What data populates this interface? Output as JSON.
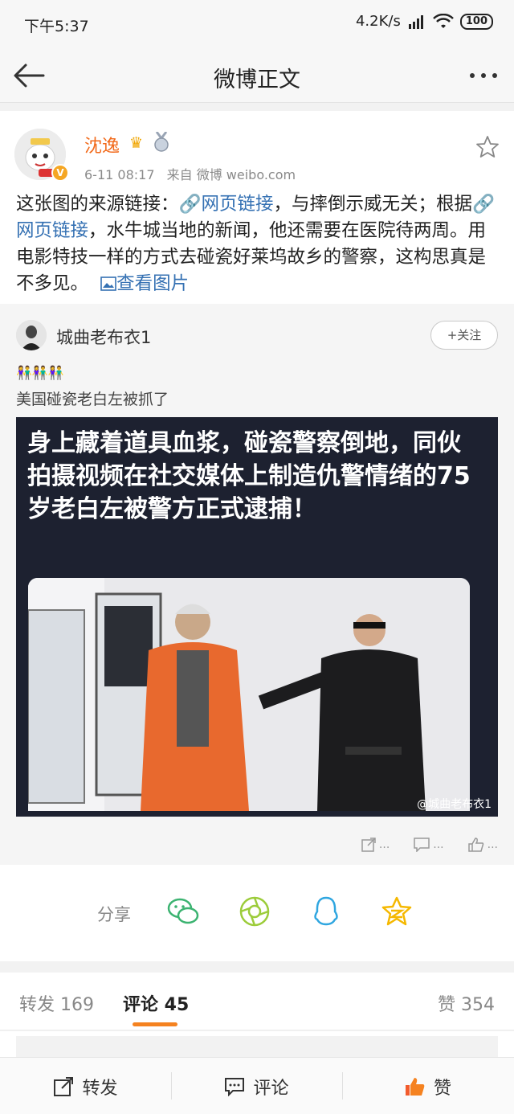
{
  "status_bar": {
    "time": "下午5:37",
    "net_speed": "4.2K/s",
    "battery": "100"
  },
  "nav": {
    "title": "微博正文"
  },
  "post": {
    "author": "沈逸",
    "time": "6-11 08:17",
    "source": "来自 微博 weibo.com",
    "text_1": "这张图的来源链接：",
    "link_1": "网页链接",
    "text_2": "，与摔倒示威无关；根据",
    "link_2": "网页链接",
    "text_3": "，水牛城当地的新闻，他还需要在医院待两周。用电影特技一样的方式去碰瓷好莱坞故乡的警察，这构思真是不多见。",
    "view_image": "查看图片"
  },
  "retweet": {
    "author": "城曲老布衣1",
    "follow_label": "+关注",
    "emoji": "👫👫👫",
    "text": "美国碰瓷老白左被抓了",
    "image_caption": "身上藏着道具血浆，碰瓷警察倒地，同伙拍摄视频在社交媒体上制造仇警情绪的75岁老白左被警方正式逮捕！",
    "watermark": "@城曲老布衣1",
    "actions": {
      "repost": "...",
      "comment": "...",
      "like": "..."
    }
  },
  "share": {
    "label": "分享"
  },
  "tabs": {
    "repost": "转发 169",
    "comment": "评论 45",
    "like": "赞 354"
  },
  "bottom": {
    "repost": "转发",
    "comment": "评论",
    "like": "赞"
  },
  "colors": {
    "accent": "#f58220",
    "link": "#3571b3",
    "author": "#f26a1b"
  }
}
